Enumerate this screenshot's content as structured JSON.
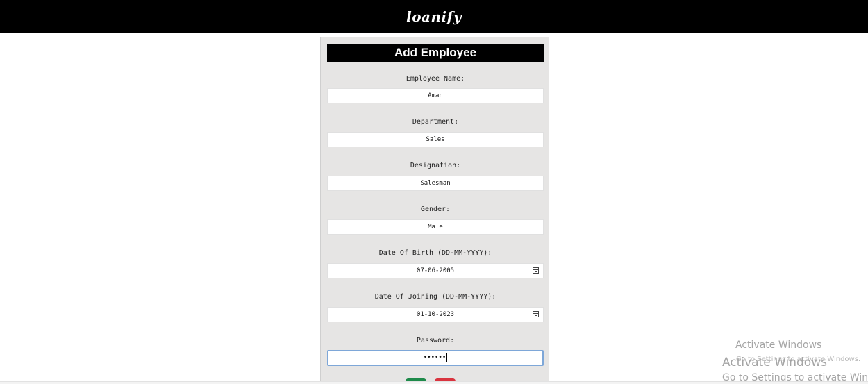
{
  "header": {
    "brand": "loanify"
  },
  "form": {
    "title": "Add Employee",
    "fields": [
      {
        "label": "Employee Name:",
        "value": "Aman"
      },
      {
        "label": "Department:",
        "value": "Sales"
      },
      {
        "label": "Designation:",
        "value": "Salesman"
      },
      {
        "label": "Gender:",
        "value": "Male"
      },
      {
        "label": "Date Of Birth (DD-MM-YYYY):",
        "value": "07-06-2005",
        "icon": "calendar-icon"
      },
      {
        "label": "Date Of Joining (DD-MM-YYYY):",
        "value": "01-10-2023",
        "icon": "calendar-icon"
      },
      {
        "label": "Password:",
        "value": "••••••",
        "focused": true
      }
    ],
    "buttons": {
      "submit_color": "#1e8a4a",
      "cancel_color": "#d9343f"
    }
  },
  "watermark": {
    "line1": "Activate Windows",
    "line2": "Go to Settings to activate Windows.",
    "line3": "Activate Windows",
    "line4": "Go to Settings to activate Windows."
  },
  "colors": {
    "header_bg": "#000000",
    "panel_bg": "#e6e5e4",
    "focus_border": "#7ea7d8"
  }
}
